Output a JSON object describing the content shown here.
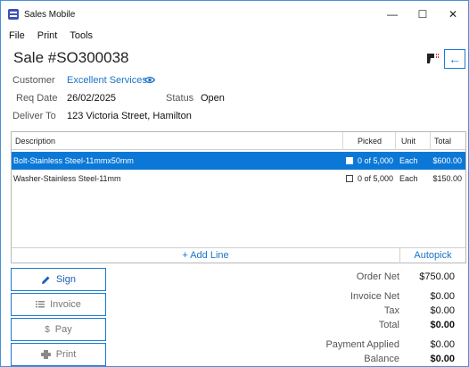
{
  "window": {
    "title": "Sales Mobile",
    "controls": {
      "minimize": "—",
      "maximize": "☐",
      "close": "✕"
    }
  },
  "menu": [
    "File",
    "Print",
    "Tools"
  ],
  "page": {
    "title": "Sale #SO300038",
    "back_glyph": "←"
  },
  "fields": {
    "customer_label": "Customer",
    "customer_value": "Excellent Services",
    "req_date_label": "Req Date",
    "req_date_value": "26/02/2025",
    "status_label": "Status",
    "status_value": "Open",
    "deliver_to_label": "Deliver To",
    "deliver_to_value": "123 Victoria Street, Hamilton"
  },
  "grid": {
    "columns": [
      "Description",
      "Picked",
      "Unit",
      "Total"
    ],
    "rows": [
      {
        "description": "Bolt-Stainless Steel-11mmx50mm",
        "picked": "0 of 5,000",
        "unit": "Each",
        "total": "$600.00",
        "selected": true
      },
      {
        "description": "Washer-Stainless Steel-11mm",
        "picked": "0 of 5,000",
        "unit": "Each",
        "total": "$150.00",
        "selected": false
      }
    ],
    "add_line": "+ Add Line",
    "autopick": "Autopick"
  },
  "actions": {
    "sign": "Sign",
    "invoice": "Invoice",
    "pay": "Pay",
    "print": "Print"
  },
  "summary": {
    "order_net_label": "Order Net",
    "order_net_value": "$750.00",
    "invoice_net_label": "Invoice Net",
    "invoice_net_value": "$0.00",
    "tax_label": "Tax",
    "tax_value": "$0.00",
    "total_label": "Total",
    "total_value": "$0.00",
    "payment_applied_label": "Payment Applied",
    "payment_applied_value": "$0.00",
    "balance_label": "Balance",
    "balance_value": "$0.00"
  },
  "colors": {
    "accent": "#1a7ad4",
    "selection": "#0b78d7",
    "link": "#1a73c8",
    "app_icon": "#3f51b5"
  },
  "icons": {
    "app": "app-icon",
    "scanner": "barcode-scanner-icon",
    "eye": "eye-icon",
    "sign": "pen-icon",
    "invoice": "list-icon",
    "pay": "dollar-icon",
    "print": "printer-icon"
  }
}
